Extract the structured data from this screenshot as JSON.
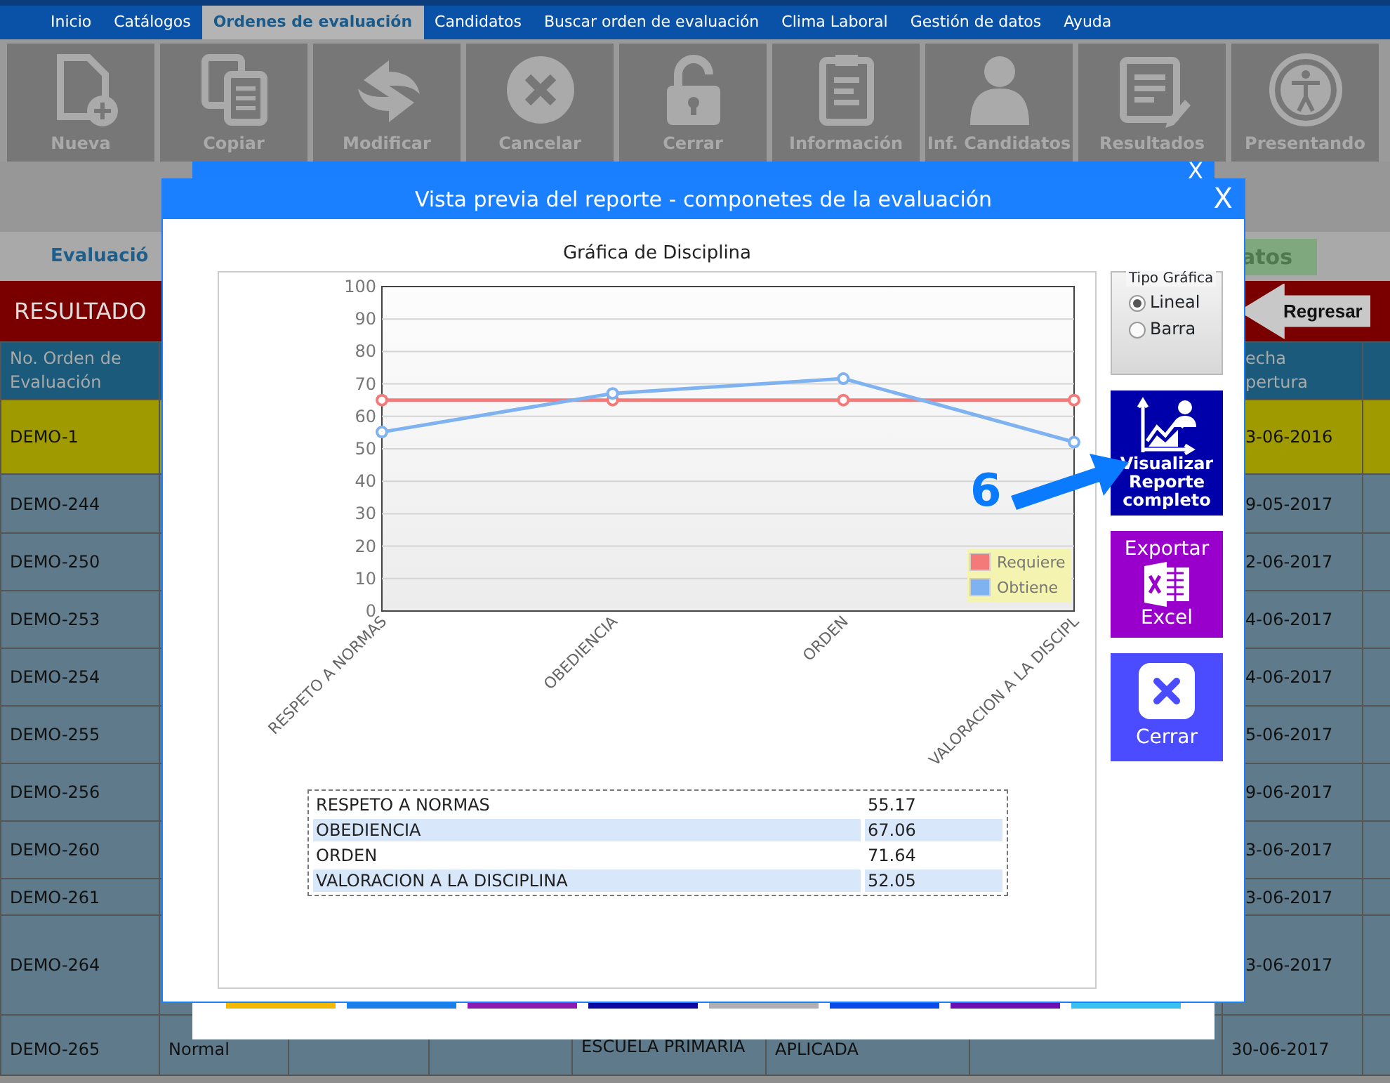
{
  "menu": [
    {
      "label": "Inicio",
      "selected": false
    },
    {
      "label": "Catálogos",
      "selected": false
    },
    {
      "label": "Ordenes de evaluación",
      "selected": true
    },
    {
      "label": "Candidatos",
      "selected": false
    },
    {
      "label": "Buscar orden de evaluación",
      "selected": false
    },
    {
      "label": "Clima Laboral",
      "selected": false
    },
    {
      "label": "Gestión de datos",
      "selected": false
    },
    {
      "label": "Ayuda",
      "selected": false
    }
  ],
  "toolbar": [
    {
      "label": "Nueva",
      "kind": "new"
    },
    {
      "label": "Copiar",
      "kind": "copy"
    },
    {
      "label": "Modificar",
      "kind": "modify"
    },
    {
      "label": "Cancelar",
      "kind": "cancel"
    },
    {
      "label": "Cerrar",
      "kind": "lock"
    },
    {
      "label": "Información",
      "kind": "info"
    },
    {
      "label": "Inf. Candidatos",
      "kind": "person"
    },
    {
      "label": "Resultados",
      "kind": "results"
    },
    {
      "label": "Presentando",
      "kind": "presenting"
    }
  ],
  "page": {
    "section_tab": "Evaluació",
    "side_tab": "atos",
    "results_title": "RESULTADO",
    "back_button": "Regresar"
  },
  "table": {
    "columns": [
      {
        "label": "No. Orden de Evaluación"
      },
      {
        "label": "echa pertura"
      }
    ],
    "rows": [
      {
        "order": "DEMO-1",
        "date": "3-06-2016",
        "selected": true
      },
      {
        "order": "DEMO-244",
        "date": "9-05-2017",
        "selected": false
      },
      {
        "order": "DEMO-250",
        "date": "2-06-2017",
        "selected": false
      },
      {
        "order": "DEMO-253",
        "date": "4-06-2017",
        "selected": false
      },
      {
        "order": "DEMO-254",
        "date": "4-06-2017",
        "selected": false
      },
      {
        "order": "DEMO-255",
        "date": "5-06-2017",
        "selected": false
      },
      {
        "order": "DEMO-256",
        "date": "9-06-2017",
        "selected": false
      },
      {
        "order": "DEMO-260",
        "date": "3-06-2017",
        "selected": false
      },
      {
        "order": "DEMO-261",
        "date": "3-06-2017",
        "selected": false
      },
      {
        "order": "DEMO-264",
        "date": "3-06-2017",
        "selected": false
      },
      {
        "order": "DEMO-265",
        "type": "Normal",
        "position": "ESCUELA PRIMARIA",
        "status": "APLICADA",
        "date": "30-06-2017",
        "selected": false
      }
    ]
  },
  "back_dialog": {
    "close": "X",
    "button_edges": [
      {
        "color": "#f5b800"
      },
      {
        "color": "#1a7fe8"
      },
      {
        "color": "#8a1ab0"
      },
      {
        "color": "#0a0aa0"
      },
      {
        "color": "#b0b0b0"
      },
      {
        "color": "#0a4ae8"
      },
      {
        "color": "#6a10b0"
      },
      {
        "color": "#3ac0f0"
      }
    ]
  },
  "dialog": {
    "title": "Vista previa del reporte - componetes de la evaluación",
    "close": "X",
    "chart_data": {
      "type": "line",
      "title": "Gráfica de Disciplina",
      "categories": [
        "RESPETO A NORMAS",
        "OBEDIENCIA",
        "ORDEN",
        "VALORACION A LA DISCIPL"
      ],
      "series": [
        {
          "name": "Requiere",
          "color": "#f47a7a",
          "marker": "circle",
          "values": [
            65,
            65,
            65,
            65
          ]
        },
        {
          "name": "Obtiene",
          "color": "#7fb2f0",
          "marker": "circle",
          "values": [
            55.17,
            67.06,
            71.64,
            52.05
          ]
        }
      ],
      "grid": true,
      "legend": true,
      "ylim": [
        0,
        100
      ],
      "yticks": [
        0,
        10,
        20,
        30,
        40,
        50,
        60,
        70,
        80,
        90,
        100
      ]
    },
    "summary": [
      {
        "label": "RESPETO A NORMAS",
        "value": "55.17"
      },
      {
        "label": "OBEDIENCIA",
        "value": "67.06"
      },
      {
        "label": "ORDEN",
        "value": "71.64"
      },
      {
        "label": "VALORACION A LA DISCIPLINA",
        "value": "52.05"
      }
    ],
    "chart_type": {
      "legend": "Tipo Gráfica",
      "options": [
        {
          "label": "Lineal",
          "selected": true
        },
        {
          "label": "Barra",
          "selected": false
        }
      ]
    },
    "actions": [
      {
        "kind": "report",
        "label": "Visualizar Reporte completo"
      },
      {
        "kind": "excel",
        "label": "Exportar",
        "sublabel": "Excel"
      },
      {
        "kind": "close",
        "label": "Cerrar"
      }
    ]
  },
  "annotation": {
    "label": "6"
  }
}
